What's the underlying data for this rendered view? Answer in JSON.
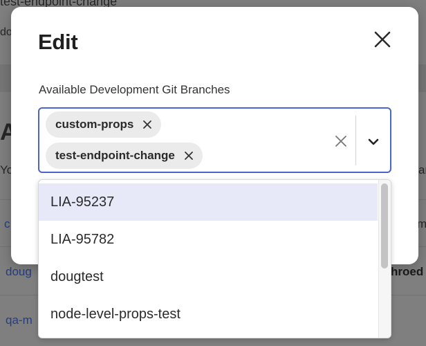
{
  "background": {
    "top_title": "test-endpoint-change",
    "top_sub": "do",
    "heading_fragment": "A",
    "row_fragment": "Yo",
    "right_fragment": "ar",
    "link_1": "c",
    "right_mid": "m",
    "link_2": "doug",
    "right_bold": "hroed",
    "link_3": "qa-m"
  },
  "modal": {
    "title": "Edit",
    "close_icon": "close-icon",
    "field_label": "Available Development Git Branches"
  },
  "select": {
    "selected": [
      {
        "label": "custom-props"
      },
      {
        "label": "test-endpoint-change"
      }
    ],
    "clear_icon": "clear-all-icon",
    "toggle_icon": "chevron-down-icon"
  },
  "menu": {
    "options": [
      {
        "label": "LIA-95237",
        "highlighted": true
      },
      {
        "label": "LIA-95782",
        "highlighted": false
      },
      {
        "label": "dougtest",
        "highlighted": false
      },
      {
        "label": "node-level-props-test",
        "highlighted": false
      }
    ]
  },
  "colors": {
    "accent_border": "#4c63c9",
    "highlight": "#e7e9f8",
    "overlay": "#7f7f7f"
  }
}
